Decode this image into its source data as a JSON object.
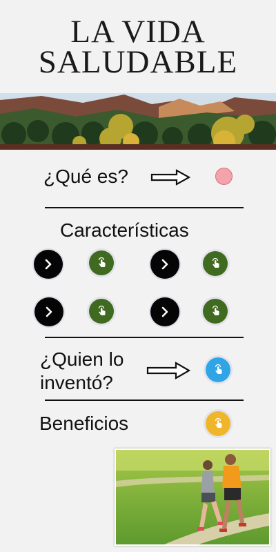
{
  "header": {
    "title_line1": "LA VIDA",
    "title_line2": "SALUDABLE"
  },
  "sections": {
    "que_es": {
      "label": "¿Qué es?"
    },
    "caracteristicas": {
      "label": "Características"
    },
    "quien": {
      "label_line1": "¿Quien lo",
      "label_line2": "inventó?"
    },
    "beneficios": {
      "label": "Beneficios"
    }
  },
  "colors": {
    "pink_dot": "#f2a3ab",
    "green_button": "#3f6a1f",
    "blue_button": "#2fa5e6",
    "yellow_button": "#f0b62a"
  },
  "icons": {
    "arrow": "right-arrow-outline-icon",
    "chevron": "chevron-right-icon",
    "tap": "tap-hand-icon"
  }
}
